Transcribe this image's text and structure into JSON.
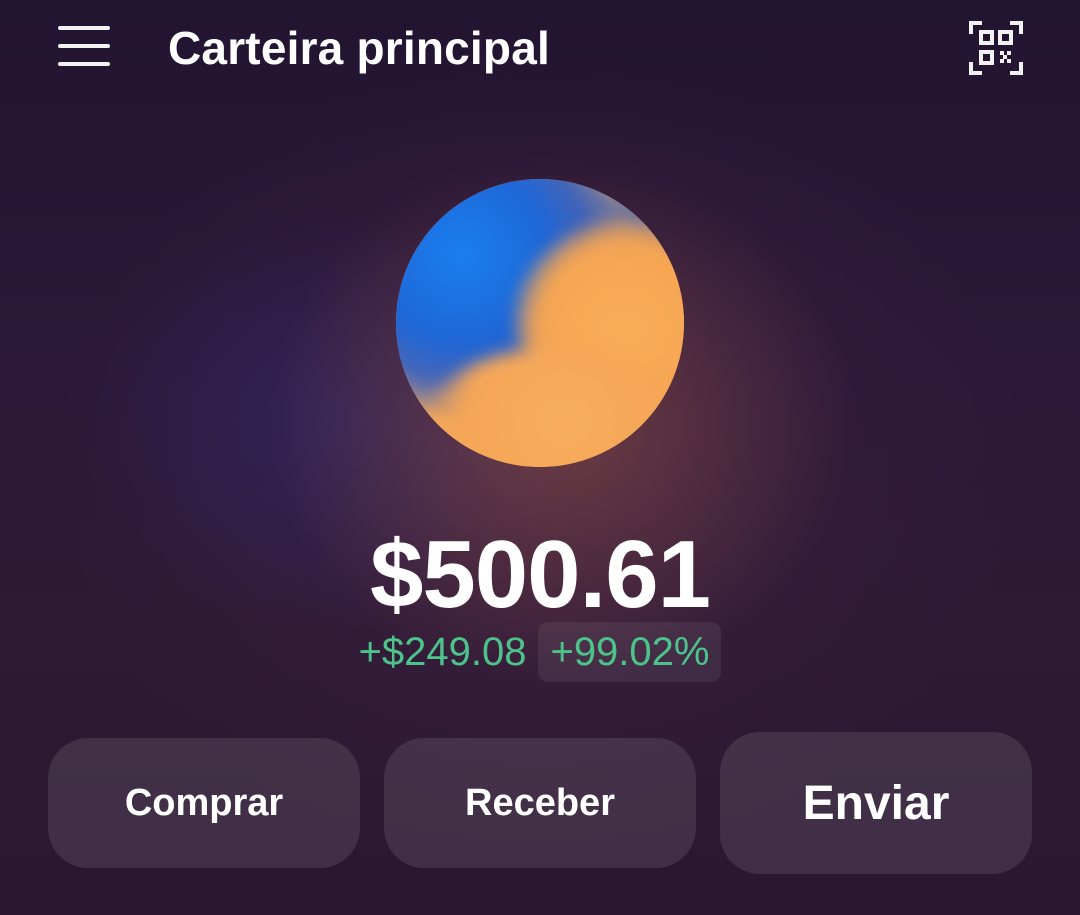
{
  "header": {
    "title": "Carteira principal",
    "menu_icon": "hamburger-menu-icon",
    "qr_icon": "qr-scan-icon"
  },
  "wallet": {
    "balance": "$500.61",
    "change_absolute": "+$249.08",
    "change_percent": "+99.02%",
    "change_color": "#4cc38a"
  },
  "actions": {
    "buy": "Comprar",
    "receive": "Receber",
    "send": "Enviar"
  }
}
